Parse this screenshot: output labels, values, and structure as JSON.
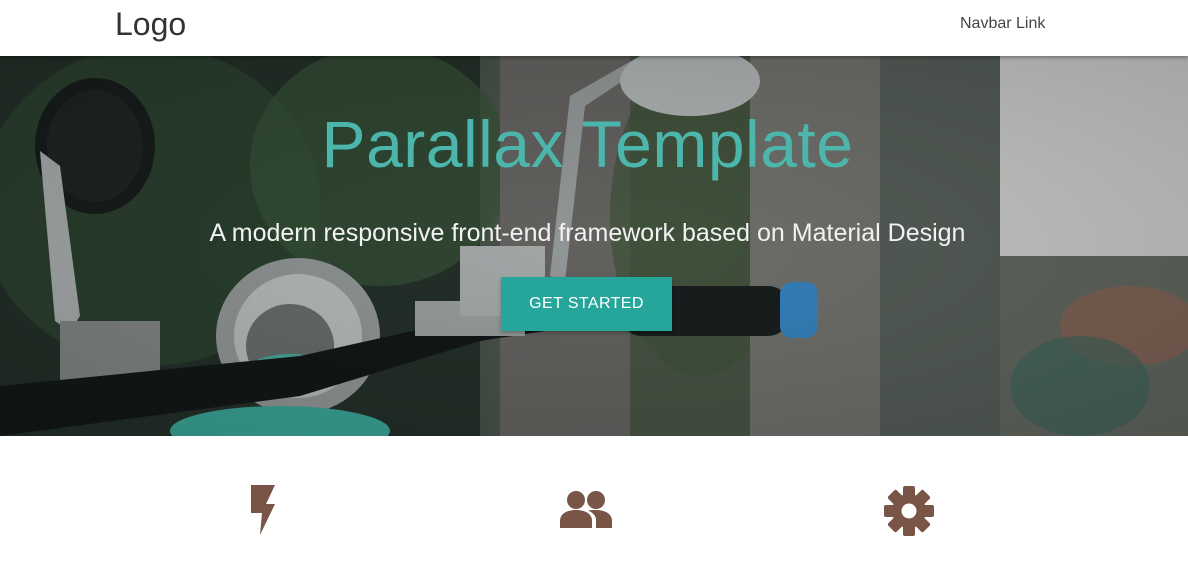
{
  "navbar": {
    "logo": "Logo",
    "link": "Navbar Link"
  },
  "hero": {
    "title": "Parallax Template",
    "subtitle": "A modern responsive front-end framework based on Material Design",
    "button_label": "GET STARTED"
  },
  "features": [
    {
      "icon": "flash-icon"
    },
    {
      "icon": "group-icon"
    },
    {
      "icon": "settings-icon"
    }
  ],
  "colors": {
    "accent": "#26a69a",
    "title": "#4db6ac",
    "icon": "#795548"
  }
}
